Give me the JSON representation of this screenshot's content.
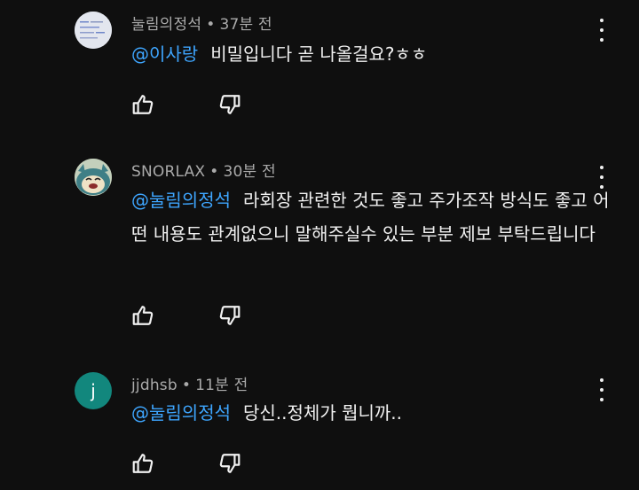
{
  "comments": [
    {
      "author": "눌림의정석",
      "time": "37분 전",
      "mention": "@이사랑",
      "text": "비밀입니다 곧 나올걸요?ㅎㅎ",
      "avatar_icon": "user-avatar-icon"
    },
    {
      "author": "SNORLAX",
      "time": "30분 전",
      "mention": "@눌림의정석",
      "text": "라회장 관련한 것도 좋고 주가조작 방식도 좋고 어떤 내용도 관계없으니 말해주실수 있는 부분 제보 부탁드립니다",
      "avatar_icon": "snorlax-avatar-icon"
    },
    {
      "author": "jjdhsb",
      "time": "11분 전",
      "mention": "@눌림의정석",
      "text": "당신..정체가 뭡니까..",
      "avatar_letter": "j"
    }
  ],
  "separator": "•",
  "icons": {
    "like": "thumbs-up-icon",
    "dislike": "thumbs-down-icon",
    "more": "more-vertical-icon"
  },
  "colors": {
    "background": "#0f0f0f",
    "text": "#f1f1f1",
    "meta": "#aaaaaa",
    "mention": "#3ea6ff",
    "avatar_j": "#12877d"
  }
}
